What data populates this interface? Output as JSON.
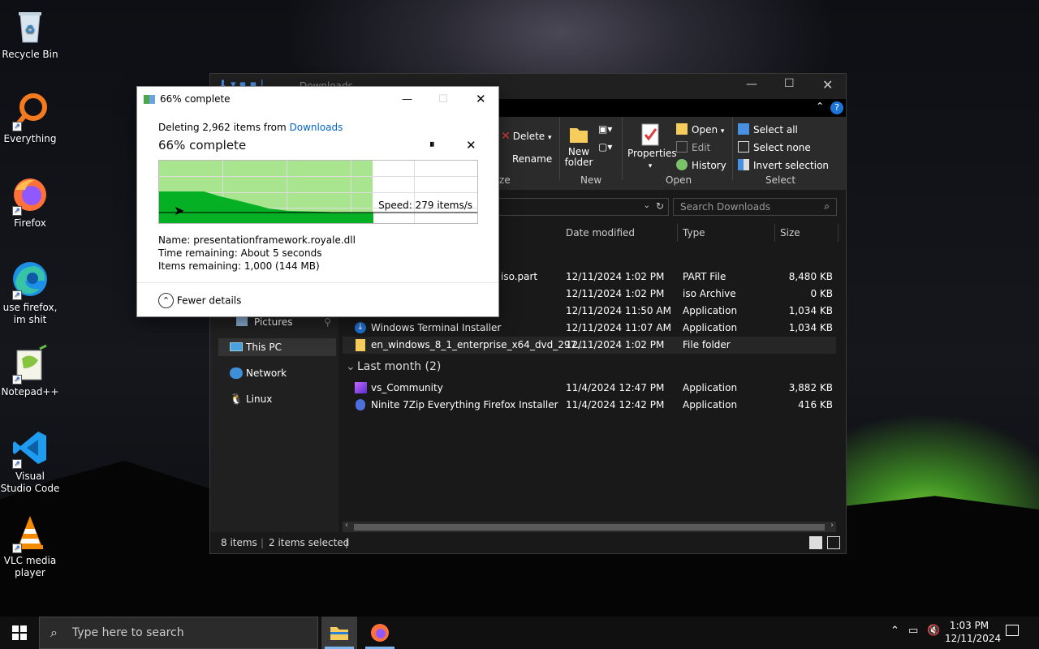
{
  "desktop": {
    "icons": [
      {
        "label": "Recycle Bin",
        "icon": "recycle-bin-icon"
      },
      {
        "label": "Everything",
        "icon": "everything-search-icon"
      },
      {
        "label": "Firefox",
        "icon": "firefox-icon"
      },
      {
        "label": "use firefox, im shit",
        "icon": "edge-icon"
      },
      {
        "label": "Notepad++",
        "icon": "notepadpp-icon"
      },
      {
        "label": "Visual Studio Code",
        "icon": "vscode-icon"
      },
      {
        "label": "VLC media player",
        "icon": "vlc-icon"
      }
    ]
  },
  "explorer": {
    "title": "Downloads",
    "ribbon": {
      "delete": "Delete",
      "rename": "Rename",
      "new_folder": "New folder",
      "new_group": "New",
      "properties": "Properties",
      "open": "Open",
      "edit": "Edit",
      "history": "History",
      "open_group": "Open",
      "select_all": "Select all",
      "select_none": "Select none",
      "invert_selection": "Invert selection",
      "select_group": "Select",
      "organize_group_tail": "ze"
    },
    "search_placeholder": "Search Downloads",
    "nav": {
      "pictures": "Pictures",
      "this_pc": "This PC",
      "network": "Network",
      "linux": "Linux"
    },
    "columns": {
      "date": "Date modified",
      "type": "Type",
      "size": "Size"
    },
    "rows": [
      {
        "name": "iso.part",
        "date": "12/11/2024 1:02 PM",
        "type": "PART File",
        "size": "8,480 KB"
      },
      {
        "name": "",
        "date": "12/11/2024 1:02 PM",
        "type": "iso Archive",
        "size": "0 KB"
      },
      {
        "name": "",
        "date": "12/11/2024 11:50 AM",
        "type": "Application",
        "size": "1,034 KB"
      },
      {
        "name": "Windows Terminal Installer",
        "date": "12/11/2024 11:07 AM",
        "type": "Application",
        "size": "1,034 KB"
      },
      {
        "name": "en_windows_8_1_enterprise_x64_dvd_297...",
        "date": "12/11/2024 1:02 PM",
        "type": "File folder",
        "size": ""
      }
    ],
    "group2": "Last month (2)",
    "rows2": [
      {
        "name": "vs_Community",
        "date": "11/4/2024 12:47 PM",
        "type": "Application",
        "size": "3,882 KB"
      },
      {
        "name": "Ninite 7Zip Everything Firefox Installer",
        "date": "11/4/2024 12:42 PM",
        "type": "Application",
        "size": "416 KB"
      }
    ],
    "status": {
      "items": "8 items",
      "selected": "2 items selected"
    }
  },
  "dialog": {
    "title": "66% complete",
    "deleting_prefix": "Deleting 2,962 items from",
    "deleting_link": "Downloads",
    "heading": "66% complete",
    "progress_fraction": 0.67,
    "speed": "Speed: 279 items/s",
    "name_label": "Name:",
    "name_value": "presentationframework.royale.dll",
    "time_label": "Time remaining:",
    "time_value": "About 5 seconds",
    "items_label": "Items remaining:",
    "items_value": "1,000 (144 MB)",
    "fewer_details": "Fewer details"
  },
  "taskbar": {
    "search_placeholder": "Type here to search",
    "time": "1:03 PM",
    "date": "12/11/2024"
  },
  "colors": {
    "progress_fill": "#a8e58e",
    "progress_dark": "#06b025",
    "link": "#0066cc"
  }
}
